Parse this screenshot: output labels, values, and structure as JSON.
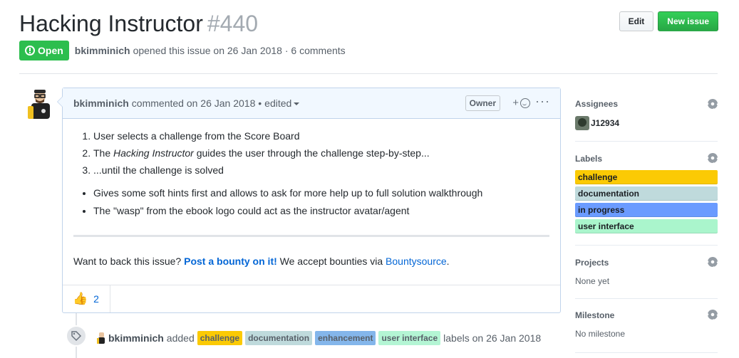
{
  "issue": {
    "title": "Hacking Instructor",
    "number": "#440",
    "state": "Open",
    "author": "bkimminich",
    "opened_text": "opened this issue on 26 Jan 2018 · 6 comments"
  },
  "header": {
    "edit_label": "Edit",
    "new_issue_label": "New issue"
  },
  "comment": {
    "author": "bkimminich",
    "meta": "commented on 26 Jan 2018 •",
    "edited": "edited",
    "owner_badge": "Owner",
    "react_plus": "+",
    "more": "···",
    "ordered": [
      "User selects a challenge from the Score Board",
      "guides the user through the challenge step-by-step...",
      "...until the challenge is solved"
    ],
    "ordered_prefix_2": "The",
    "ordered_em_2": "Hacking Instructor",
    "bullets": [
      "Gives some soft hints first and allows to ask for more help up to full solution walkthrough",
      "The \"wasp\" from the ebook logo could act as the instructor avatar/agent"
    ],
    "bounty_prefix": "Want to back this issue?",
    "bounty_link": "Post a bounty on it!",
    "bounty_mid": "We accept bounties via",
    "bounty_source": "Bountysource",
    "bounty_end": ".",
    "thumbs_count": "2"
  },
  "event": {
    "author": "bkimminich",
    "action": "added",
    "labels": [
      {
        "name": "challenge",
        "color": "#fbca04"
      },
      {
        "name": "documentation",
        "color": "#bfdadc"
      },
      {
        "name": "enhancement",
        "color": "#84b6eb"
      },
      {
        "name": "user interface",
        "color": "#b4f5d4"
      }
    ],
    "suffix": "labels on 26 Jan 2018"
  },
  "sidebar": {
    "assignees_title": "Assignees",
    "assignee": "J12934",
    "labels_title": "Labels",
    "labels": [
      {
        "name": "challenge",
        "color": "#fbca04"
      },
      {
        "name": "documentation",
        "color": "#bfdadc"
      },
      {
        "name": "in progress",
        "color": "#6b9bff"
      },
      {
        "name": "user interface",
        "color": "#aaf5cc"
      }
    ],
    "projects_title": "Projects",
    "projects_value": "None yet",
    "milestone_title": "Milestone",
    "milestone_value": "No milestone"
  },
  "colors": {
    "open_green": "#2cbe4e",
    "link_blue": "#0366d6"
  },
  "icons": [
    "issue-opened-icon",
    "smiley-icon",
    "kebab-icon",
    "thumbs-up-icon",
    "tag-icon",
    "gear-icon"
  ]
}
